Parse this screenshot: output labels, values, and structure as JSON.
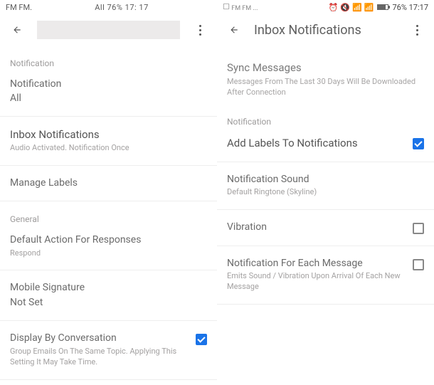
{
  "left": {
    "status": {
      "carrier": "FM FM.",
      "center": "All 76% 17: 17"
    },
    "sections": {
      "notif_header": "Notification",
      "notif_label": "Notification",
      "notif_value": "All",
      "inbox_title": "Inbox Notifications",
      "inbox_sub": "Audio Activated. Notification Once",
      "manage_labels": "Manage Labels",
      "general": "General",
      "default_action_title": "Default Action For Responses",
      "default_action_value": "Respond",
      "mobile_sig_title": "Mobile Signature",
      "mobile_sig_value": "Not Set",
      "display_conv_title": "Display By Conversation",
      "display_conv_sub": "Group Emails On The Same Topic. Applying This Setting It May Take Time."
    }
  },
  "right": {
    "status": {
      "left": "FM FM ...",
      "right": "76% 17:17"
    },
    "title": "Inbox Notifications",
    "sync_title": "Sync Messages",
    "sync_sub": "Messages From The Last 30 Days Will Be Downloaded After Connection",
    "notif_header": "Notification",
    "add_labels": "Add Labels To Notifications",
    "sound_title": "Notification Sound",
    "sound_value": "Default Ringtone (Skyline)",
    "vibration": "Vibration",
    "each_msg_title": "Notification For Each Message",
    "each_msg_sub": "Emits Sound / Vibration Upon Arrival Of Each New Message"
  }
}
